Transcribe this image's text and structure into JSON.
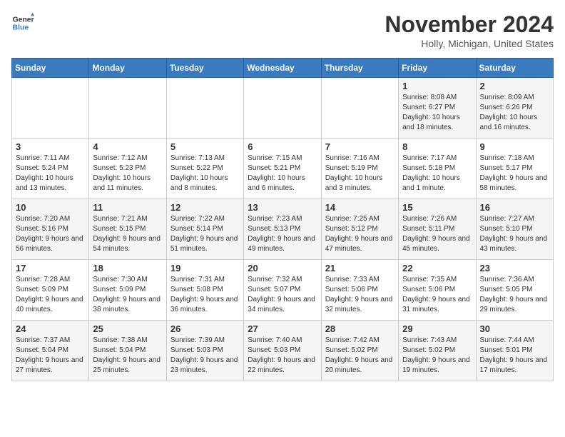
{
  "header": {
    "logo_line1": "General",
    "logo_line2": "Blue",
    "month": "November 2024",
    "location": "Holly, Michigan, United States"
  },
  "days_of_week": [
    "Sunday",
    "Monday",
    "Tuesday",
    "Wednesday",
    "Thursday",
    "Friday",
    "Saturday"
  ],
  "weeks": [
    [
      {
        "day": "",
        "info": ""
      },
      {
        "day": "",
        "info": ""
      },
      {
        "day": "",
        "info": ""
      },
      {
        "day": "",
        "info": ""
      },
      {
        "day": "",
        "info": ""
      },
      {
        "day": "1",
        "info": "Sunrise: 8:08 AM\nSunset: 6:27 PM\nDaylight: 10 hours and 18 minutes."
      },
      {
        "day": "2",
        "info": "Sunrise: 8:09 AM\nSunset: 6:26 PM\nDaylight: 10 hours and 16 minutes."
      }
    ],
    [
      {
        "day": "3",
        "info": "Sunrise: 7:11 AM\nSunset: 5:24 PM\nDaylight: 10 hours and 13 minutes."
      },
      {
        "day": "4",
        "info": "Sunrise: 7:12 AM\nSunset: 5:23 PM\nDaylight: 10 hours and 11 minutes."
      },
      {
        "day": "5",
        "info": "Sunrise: 7:13 AM\nSunset: 5:22 PM\nDaylight: 10 hours and 8 minutes."
      },
      {
        "day": "6",
        "info": "Sunrise: 7:15 AM\nSunset: 5:21 PM\nDaylight: 10 hours and 6 minutes."
      },
      {
        "day": "7",
        "info": "Sunrise: 7:16 AM\nSunset: 5:19 PM\nDaylight: 10 hours and 3 minutes."
      },
      {
        "day": "8",
        "info": "Sunrise: 7:17 AM\nSunset: 5:18 PM\nDaylight: 10 hours and 1 minute."
      },
      {
        "day": "9",
        "info": "Sunrise: 7:18 AM\nSunset: 5:17 PM\nDaylight: 9 hours and 58 minutes."
      }
    ],
    [
      {
        "day": "10",
        "info": "Sunrise: 7:20 AM\nSunset: 5:16 PM\nDaylight: 9 hours and 56 minutes."
      },
      {
        "day": "11",
        "info": "Sunrise: 7:21 AM\nSunset: 5:15 PM\nDaylight: 9 hours and 54 minutes."
      },
      {
        "day": "12",
        "info": "Sunrise: 7:22 AM\nSunset: 5:14 PM\nDaylight: 9 hours and 51 minutes."
      },
      {
        "day": "13",
        "info": "Sunrise: 7:23 AM\nSunset: 5:13 PM\nDaylight: 9 hours and 49 minutes."
      },
      {
        "day": "14",
        "info": "Sunrise: 7:25 AM\nSunset: 5:12 PM\nDaylight: 9 hours and 47 minutes."
      },
      {
        "day": "15",
        "info": "Sunrise: 7:26 AM\nSunset: 5:11 PM\nDaylight: 9 hours and 45 minutes."
      },
      {
        "day": "16",
        "info": "Sunrise: 7:27 AM\nSunset: 5:10 PM\nDaylight: 9 hours and 43 minutes."
      }
    ],
    [
      {
        "day": "17",
        "info": "Sunrise: 7:28 AM\nSunset: 5:09 PM\nDaylight: 9 hours and 40 minutes."
      },
      {
        "day": "18",
        "info": "Sunrise: 7:30 AM\nSunset: 5:09 PM\nDaylight: 9 hours and 38 minutes."
      },
      {
        "day": "19",
        "info": "Sunrise: 7:31 AM\nSunset: 5:08 PM\nDaylight: 9 hours and 36 minutes."
      },
      {
        "day": "20",
        "info": "Sunrise: 7:32 AM\nSunset: 5:07 PM\nDaylight: 9 hours and 34 minutes."
      },
      {
        "day": "21",
        "info": "Sunrise: 7:33 AM\nSunset: 5:06 PM\nDaylight: 9 hours and 32 minutes."
      },
      {
        "day": "22",
        "info": "Sunrise: 7:35 AM\nSunset: 5:06 PM\nDaylight: 9 hours and 31 minutes."
      },
      {
        "day": "23",
        "info": "Sunrise: 7:36 AM\nSunset: 5:05 PM\nDaylight: 9 hours and 29 minutes."
      }
    ],
    [
      {
        "day": "24",
        "info": "Sunrise: 7:37 AM\nSunset: 5:04 PM\nDaylight: 9 hours and 27 minutes."
      },
      {
        "day": "25",
        "info": "Sunrise: 7:38 AM\nSunset: 5:04 PM\nDaylight: 9 hours and 25 minutes."
      },
      {
        "day": "26",
        "info": "Sunrise: 7:39 AM\nSunset: 5:03 PM\nDaylight: 9 hours and 23 minutes."
      },
      {
        "day": "27",
        "info": "Sunrise: 7:40 AM\nSunset: 5:03 PM\nDaylight: 9 hours and 22 minutes."
      },
      {
        "day": "28",
        "info": "Sunrise: 7:42 AM\nSunset: 5:02 PM\nDaylight: 9 hours and 20 minutes."
      },
      {
        "day": "29",
        "info": "Sunrise: 7:43 AM\nSunset: 5:02 PM\nDaylight: 9 hours and 19 minutes."
      },
      {
        "day": "30",
        "info": "Sunrise: 7:44 AM\nSunset: 5:01 PM\nDaylight: 9 hours and 17 minutes."
      }
    ]
  ]
}
